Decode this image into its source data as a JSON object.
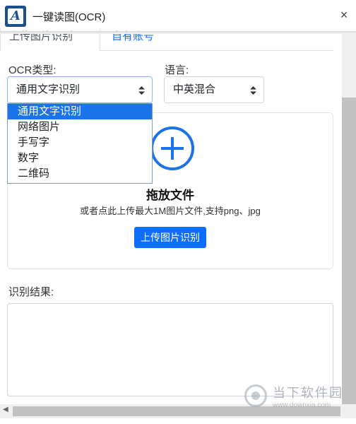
{
  "window": {
    "title": "一键读图(OCR)",
    "logo_letter": "A",
    "close_label": "×"
  },
  "tabs": [
    {
      "label": "上传图片识别",
      "active": true
    },
    {
      "label": "自有账号",
      "active": false
    }
  ],
  "ocr_type": {
    "label": "OCR类型:",
    "selected": "通用文字识别",
    "options": [
      "通用文字识别",
      "网络图片",
      "手写字",
      "数字",
      "二维码"
    ]
  },
  "language": {
    "label": "语言:",
    "selected": "中英混合"
  },
  "dropzone": {
    "title": "拖放文件",
    "subtitle": "或者点此上传最大1M图片文件,支持png、jpg",
    "button_label": "上传图片识别",
    "icon": "plus-circle-icon",
    "accent_color": "#0d6efd"
  },
  "result": {
    "label": "识别结果:",
    "value": ""
  },
  "watermark": {
    "main": "当下软件园",
    "sub": "www.downxia.com"
  }
}
